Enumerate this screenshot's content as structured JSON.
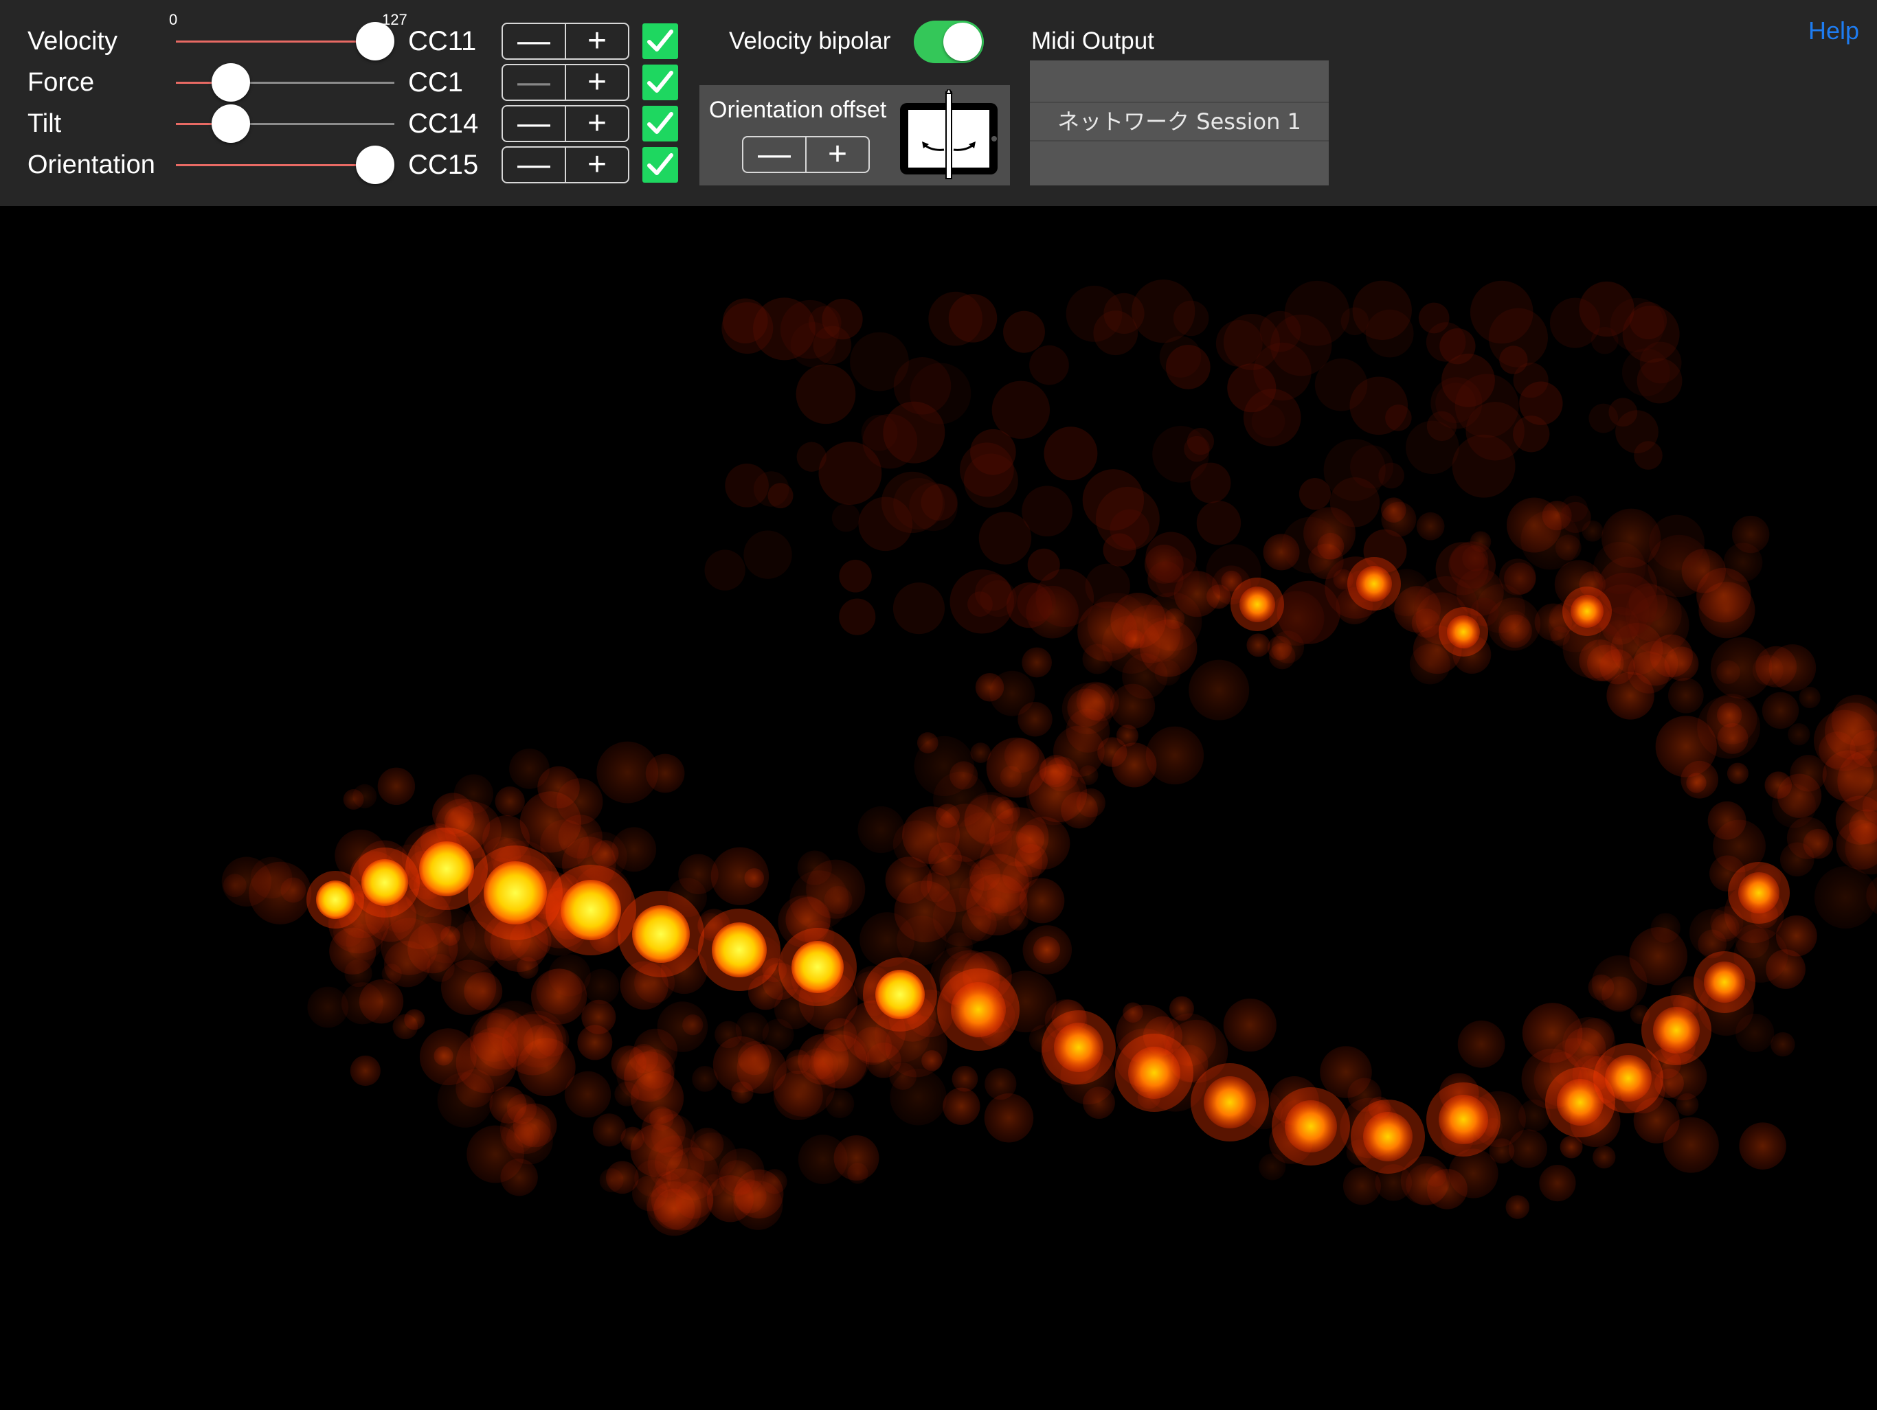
{
  "toolbar": {
    "slider_min_label": "0",
    "slider_max_label": "127",
    "rows": [
      {
        "label": "Velocity",
        "cc": "CC11",
        "value": 127,
        "minus_enabled": true,
        "checked": true
      },
      {
        "label": "Force",
        "cc": "CC1",
        "value": 25,
        "minus_enabled": false,
        "checked": true
      },
      {
        "label": "Tilt",
        "cc": "CC14",
        "value": 25,
        "minus_enabled": true,
        "checked": true
      },
      {
        "label": "Orientation",
        "cc": "CC15",
        "value": 127,
        "minus_enabled": true,
        "checked": true
      }
    ],
    "minus_symbol": "—",
    "plus_symbol": "+",
    "velocity_bipolar_label": "Velocity bipolar",
    "velocity_bipolar_on": true,
    "orientation_offset_label": "Orientation offset",
    "midi_output_label": "Midi Output",
    "midi_output_selected": "ネットワーク Session 1",
    "help_label": "Help"
  },
  "colors": {
    "toolbar_bg": "#262626",
    "slider_fill": "#e86a64",
    "toggle_on": "#34c759",
    "check_green": "#1ed760",
    "help_link": "#1e7cf0"
  },
  "icons": {
    "checkbox": "checkmark-icon",
    "orientation_preview": "ipad-pencil-icon"
  }
}
